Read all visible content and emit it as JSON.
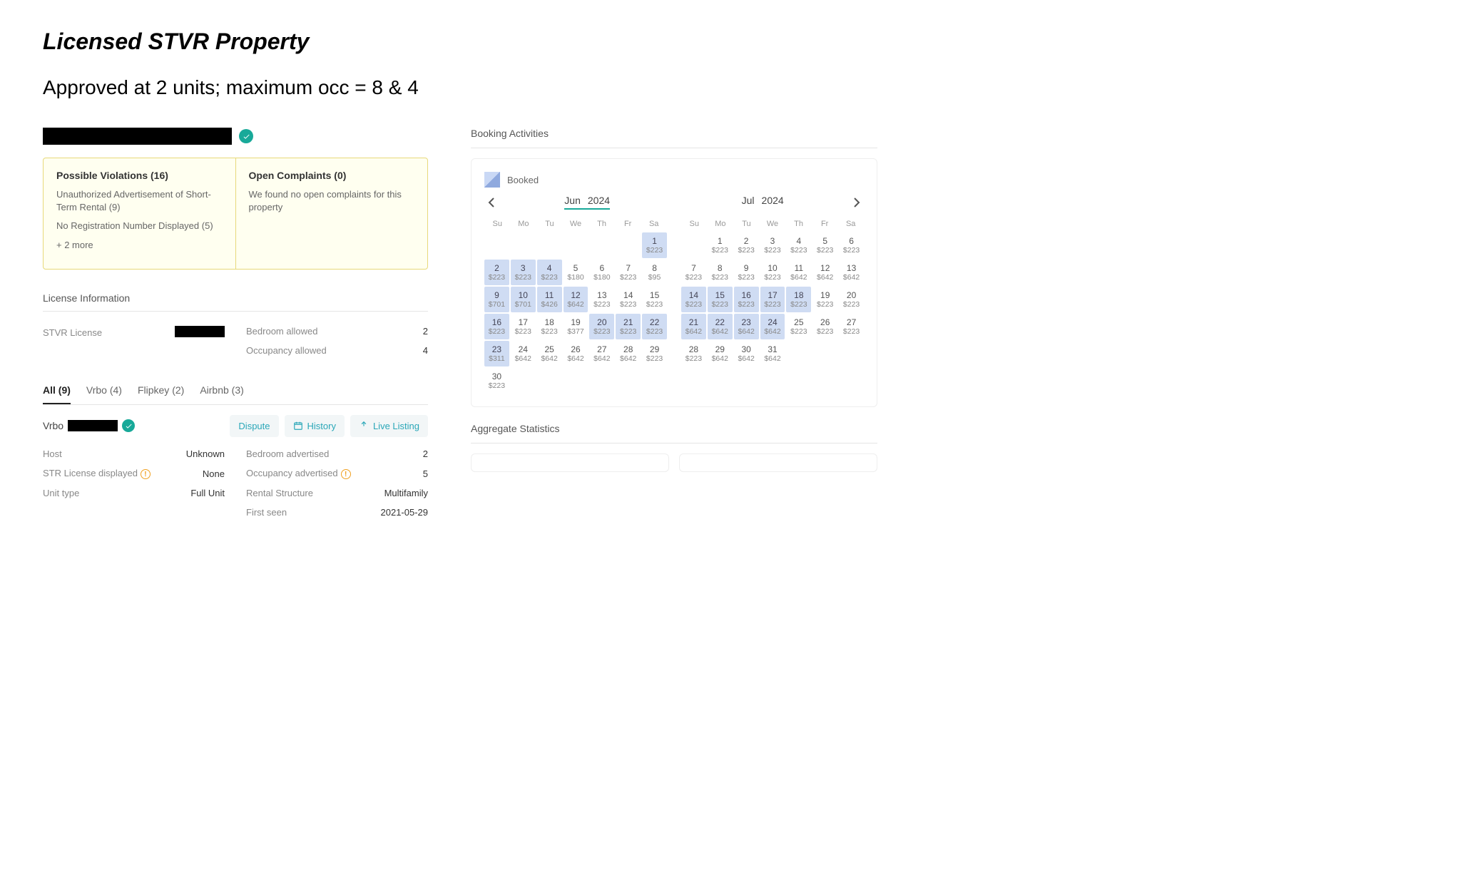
{
  "page": {
    "title": "Licensed STVR Property",
    "subtitle": "Approved at 2 units; maximum occ = 8 & 4"
  },
  "violations": {
    "title": "Possible Violations (16)",
    "items": [
      "Unauthorized Advertisement of Short-Term Rental (9)",
      "No Registration Number Displayed (5)",
      "+ 2 more"
    ]
  },
  "complaints": {
    "title": "Open Complaints (0)",
    "body": "We found no open complaints for this property"
  },
  "licenseSection": {
    "header": "License Information",
    "left": [
      {
        "label": "STVR License",
        "value": "",
        "redacted": true
      }
    ],
    "right": [
      {
        "label": "Bedroom allowed",
        "value": "2"
      },
      {
        "label": "Occupancy allowed",
        "value": "4"
      }
    ]
  },
  "tabs": [
    {
      "label": "All (9)",
      "active": true
    },
    {
      "label": "Vrbo (4)"
    },
    {
      "label": "Flipkey (2)"
    },
    {
      "label": "Airbnb (3)"
    }
  ],
  "listing": {
    "platform": "Vrbo",
    "actions": {
      "dispute": "Dispute",
      "history": "History",
      "live": "Live Listing"
    },
    "left": [
      {
        "label": "Host",
        "value": "Unknown"
      },
      {
        "label": "STR License displayed",
        "value": "None",
        "warn": true
      },
      {
        "label": "Unit type",
        "value": "Full Unit"
      }
    ],
    "right": [
      {
        "label": "Bedroom advertised",
        "value": "2"
      },
      {
        "label": "Occupancy advertised",
        "value": "5",
        "warn": true
      },
      {
        "label": "Rental Structure",
        "value": "Multifamily"
      },
      {
        "label": "First seen",
        "value": "2021-05-29"
      }
    ]
  },
  "booking": {
    "title": "Booking Activities",
    "legend": "Booked",
    "dow": [
      "Su",
      "Mo",
      "Tu",
      "We",
      "Th",
      "Fr",
      "Sa"
    ],
    "months": [
      {
        "name": "Jun",
        "year": "2024",
        "active": true
      },
      {
        "name": "Jul",
        "year": "2024"
      }
    ],
    "calendars": [
      {
        "weeks": [
          [
            null,
            null,
            null,
            null,
            null,
            null,
            {
              "d": 1,
              "p": "$223",
              "b": true
            }
          ],
          [
            {
              "d": 2,
              "p": "$223",
              "b": true
            },
            {
              "d": 3,
              "p": "$223",
              "b": true
            },
            {
              "d": 4,
              "p": "$223",
              "b": true
            },
            {
              "d": 5,
              "p": "$180"
            },
            {
              "d": 6,
              "p": "$180"
            },
            {
              "d": 7,
              "p": "$223"
            },
            {
              "d": 8,
              "p": "$95"
            }
          ],
          [
            {
              "d": 9,
              "p": "$701",
              "b": true
            },
            {
              "d": 10,
              "p": "$701",
              "b": true
            },
            {
              "d": 11,
              "p": "$426",
              "b": true
            },
            {
              "d": 12,
              "p": "$642",
              "b": true
            },
            {
              "d": 13,
              "p": "$223"
            },
            {
              "d": 14,
              "p": "$223"
            },
            {
              "d": 15,
              "p": "$223"
            }
          ],
          [
            {
              "d": 16,
              "p": "$223",
              "b": true
            },
            {
              "d": 17,
              "p": "$223"
            },
            {
              "d": 18,
              "p": "$223"
            },
            {
              "d": 19,
              "p": "$377"
            },
            {
              "d": 20,
              "p": "$223",
              "b": true
            },
            {
              "d": 21,
              "p": "$223",
              "b": true
            },
            {
              "d": 22,
              "p": "$223",
              "b": true
            }
          ],
          [
            {
              "d": 23,
              "p": "$311",
              "b": true
            },
            {
              "d": 24,
              "p": "$642"
            },
            {
              "d": 25,
              "p": "$642"
            },
            {
              "d": 26,
              "p": "$642"
            },
            {
              "d": 27,
              "p": "$642"
            },
            {
              "d": 28,
              "p": "$642"
            },
            {
              "d": 29,
              "p": "$223"
            }
          ],
          [
            {
              "d": 30,
              "p": "$223"
            },
            null,
            null,
            null,
            null,
            null,
            null
          ]
        ]
      },
      {
        "weeks": [
          [
            null,
            {
              "d": 1,
              "p": "$223"
            },
            {
              "d": 2,
              "p": "$223"
            },
            {
              "d": 3,
              "p": "$223"
            },
            {
              "d": 4,
              "p": "$223"
            },
            {
              "d": 5,
              "p": "$223"
            },
            {
              "d": 6,
              "p": "$223"
            }
          ],
          [
            {
              "d": 7,
              "p": "$223"
            },
            {
              "d": 8,
              "p": "$223"
            },
            {
              "d": 9,
              "p": "$223"
            },
            {
              "d": 10,
              "p": "$223"
            },
            {
              "d": 11,
              "p": "$642"
            },
            {
              "d": 12,
              "p": "$642"
            },
            {
              "d": 13,
              "p": "$642"
            }
          ],
          [
            {
              "d": 14,
              "p": "$223",
              "b": true
            },
            {
              "d": 15,
              "p": "$223",
              "b": true
            },
            {
              "d": 16,
              "p": "$223",
              "b": true
            },
            {
              "d": 17,
              "p": "$223",
              "b": true
            },
            {
              "d": 18,
              "p": "$223",
              "b": true
            },
            {
              "d": 19,
              "p": "$223"
            },
            {
              "d": 20,
              "p": "$223"
            }
          ],
          [
            {
              "d": 21,
              "p": "$642",
              "b": true
            },
            {
              "d": 22,
              "p": "$642",
              "b": true
            },
            {
              "d": 23,
              "p": "$642",
              "b": true
            },
            {
              "d": 24,
              "p": "$642",
              "b": true
            },
            {
              "d": 25,
              "p": "$223"
            },
            {
              "d": 26,
              "p": "$223"
            },
            {
              "d": 27,
              "p": "$223"
            }
          ],
          [
            {
              "d": 28,
              "p": "$223"
            },
            {
              "d": 29,
              "p": "$642"
            },
            {
              "d": 30,
              "p": "$642"
            },
            {
              "d": 31,
              "p": "$642"
            },
            null,
            null,
            null
          ]
        ]
      }
    ]
  },
  "aggregate": {
    "title": "Aggregate Statistics"
  }
}
